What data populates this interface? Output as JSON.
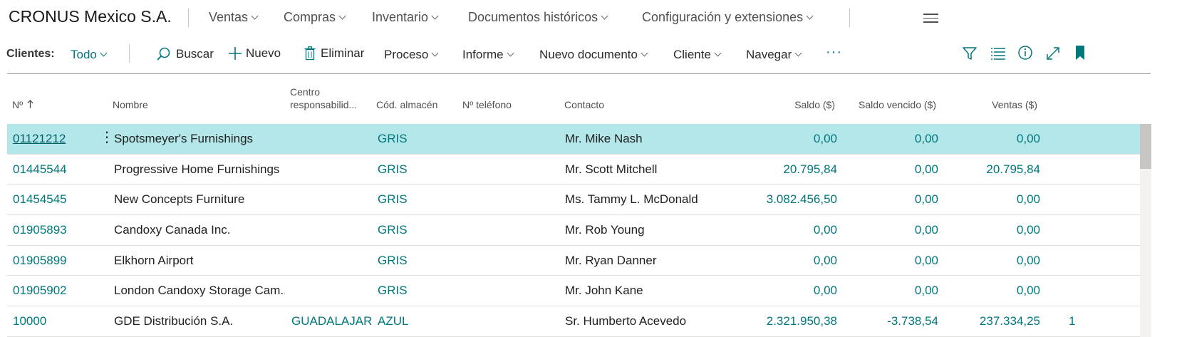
{
  "company": "CRONUS Mexico S.A.",
  "menus": [
    "Ventas",
    "Compras",
    "Inventario",
    "Documentos históricos",
    "Configuración y extensiones"
  ],
  "actionbar": {
    "list_label": "Clientes:",
    "view": "Todo",
    "search": "Buscar",
    "new": "Nuevo",
    "delete": "Eliminar",
    "process": "Proceso",
    "report": "Informe",
    "new_document": "Nuevo documento",
    "customer": "Cliente",
    "navigate": "Navegar",
    "more": "···"
  },
  "columns": {
    "no": "Nº",
    "name": "Nombre",
    "center_line1": "Centro",
    "center_line2": "responsabilid...",
    "location": "Cód. almacén",
    "phone": "Nº teléfono",
    "contact": "Contacto",
    "balance": "Saldo ($)",
    "overdue": "Saldo vencido ($)",
    "sales": "Ventas ($)"
  },
  "rows": [
    {
      "no": "01121212",
      "name": "Spotsmeyer's Furnishings",
      "center": "",
      "location": "GRIS",
      "phone": "",
      "contact": "Mr. Mike Nash",
      "balance": "0,00",
      "overdue": "0,00",
      "sales": "0,00",
      "extra": ""
    },
    {
      "no": "01445544",
      "name": "Progressive Home Furnishings",
      "center": "",
      "location": "GRIS",
      "phone": "",
      "contact": "Mr. Scott Mitchell",
      "balance": "20.795,84",
      "overdue": "0,00",
      "sales": "20.795,84",
      "extra": ""
    },
    {
      "no": "01454545",
      "name": "New Concepts Furniture",
      "center": "",
      "location": "GRIS",
      "phone": "",
      "contact": "Ms. Tammy L. McDonald",
      "balance": "3.082.456,50",
      "overdue": "0,00",
      "sales": "0,00",
      "extra": ""
    },
    {
      "no": "01905893",
      "name": "Candoxy Canada Inc.",
      "center": "",
      "location": "GRIS",
      "phone": "",
      "contact": "Mr. Rob Young",
      "balance": "0,00",
      "overdue": "0,00",
      "sales": "0,00",
      "extra": ""
    },
    {
      "no": "01905899",
      "name": "Elkhorn Airport",
      "center": "",
      "location": "GRIS",
      "phone": "",
      "contact": "Mr. Ryan Danner",
      "balance": "0,00",
      "overdue": "0,00",
      "sales": "0,00",
      "extra": ""
    },
    {
      "no": "01905902",
      "name": "London Candoxy Storage Cam...",
      "center": "",
      "location": "GRIS",
      "phone": "",
      "contact": "Mr. John Kane",
      "balance": "0,00",
      "overdue": "0,00",
      "sales": "0,00",
      "extra": ""
    },
    {
      "no": "10000",
      "name": "GDE Distribución S.A.",
      "center": "GUADALAJAR",
      "location": "AZUL",
      "phone": "",
      "contact": "Sr. Humberto Acevedo",
      "balance": "2.321.950,38",
      "overdue": "-3.738,54",
      "sales": "237.334,25",
      "extra": "1"
    }
  ],
  "colors": {
    "accent": "#00777d",
    "selected_row": "#b3e7ea"
  }
}
